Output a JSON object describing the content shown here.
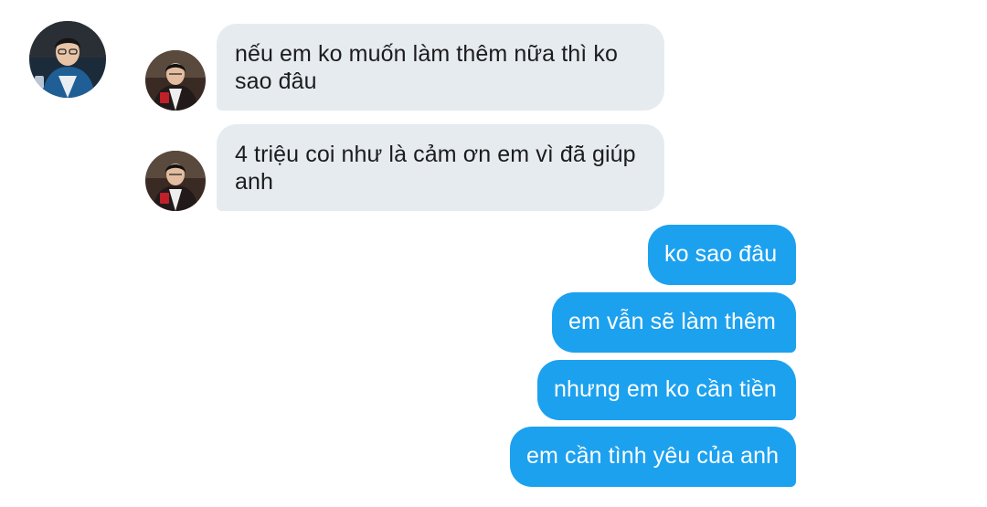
{
  "conversation": {
    "messages": [
      {
        "direction": "incoming",
        "text": "nếu em ko muốn làm thêm nữa thì ko sao đâu"
      },
      {
        "direction": "incoming",
        "text": "4 triệu coi như là cảm ơn em vì đã giúp anh"
      },
      {
        "direction": "outgoing",
        "text": "ko sao đâu"
      },
      {
        "direction": "outgoing",
        "text": "em vẫn sẽ làm thêm"
      },
      {
        "direction": "outgoing",
        "text": "nhưng em ko cần tiền"
      },
      {
        "direction": "outgoing",
        "text": "em cần tình yêu của anh"
      }
    ]
  },
  "colors": {
    "incoming_bubble": "#e6ebf0",
    "outgoing_bubble": "#1ca1ef",
    "incoming_text": "#1c1c1c",
    "outgoing_text": "#ffffff"
  }
}
